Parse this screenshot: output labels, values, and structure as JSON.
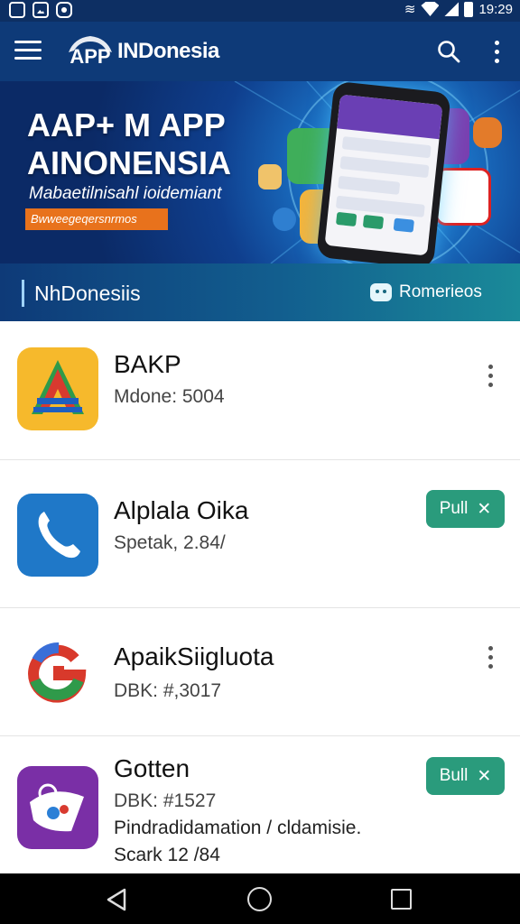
{
  "status_bar": {
    "time": "19:29"
  },
  "app_bar": {
    "title": "INDonesia",
    "logo_text": "APP"
  },
  "banner": {
    "headline_line1": "AAP+ M APP",
    "headline_line2": "AINONENSIA",
    "subtitle": "Mabaetilnisahl ioidemiant",
    "tag": "Bwweegeqersnrmos"
  },
  "section": {
    "title": "NhDonesiis",
    "action_label": "Romerieos"
  },
  "apps": [
    {
      "name": "BAKP",
      "meta": [
        "Mdone: 5004"
      ],
      "action": "menu"
    },
    {
      "name": "Alplala Oika",
      "meta": [
        "Spetak, 2.84/"
      ],
      "action": "pull",
      "action_label": "Pull",
      "action_icon": "close-icon"
    },
    {
      "name": "ApaikSiigluota",
      "meta": [
        "DBK: #,3017"
      ],
      "action": "menu"
    },
    {
      "name": "Gotten",
      "meta": [
        "DBK: #1527",
        "Pindradidamation / cldamisie.",
        "Scark 12 /84"
      ],
      "action": "pull",
      "action_label": "Bull",
      "action_icon": "close-icon"
    }
  ],
  "colors": {
    "app_bar": "#0e3a78",
    "accent_green": "#2a9b7c",
    "banner_tag": "#e8721c"
  }
}
